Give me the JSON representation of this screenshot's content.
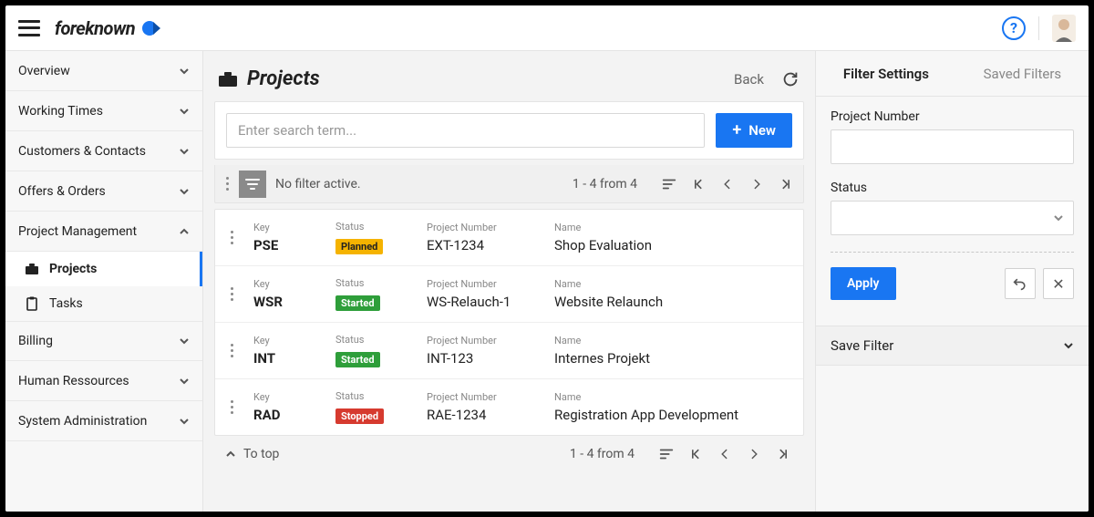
{
  "brand": "foreknown",
  "sidebar": {
    "items": [
      {
        "label": "Overview",
        "expanded": false
      },
      {
        "label": "Working Times",
        "expanded": false
      },
      {
        "label": "Customers & Contacts",
        "expanded": false
      },
      {
        "label": "Offers & Orders",
        "expanded": false
      },
      {
        "label": "Project Management",
        "expanded": true,
        "children": [
          {
            "label": "Projects",
            "active": true
          },
          {
            "label": "Tasks",
            "active": false
          }
        ]
      },
      {
        "label": "Billing",
        "expanded": false
      },
      {
        "label": "Human Ressources",
        "expanded": false
      },
      {
        "label": "System Administration",
        "expanded": false
      }
    ]
  },
  "page": {
    "title": "Projects",
    "back_label": "Back"
  },
  "search": {
    "placeholder": "Enter search term...",
    "new_label": "New"
  },
  "filter_bar": {
    "status_text": "No filter active.",
    "range_text": "1 - 4 from 4"
  },
  "columns": {
    "key": "Key",
    "status": "Status",
    "project_number": "Project Number",
    "name": "Name"
  },
  "rows": [
    {
      "key": "PSE",
      "status": "Planned",
      "project_number": "EXT-1234",
      "name": "Shop Evaluation"
    },
    {
      "key": "WSR",
      "status": "Started",
      "project_number": "WS-Relauch-1",
      "name": "Website Relaunch"
    },
    {
      "key": "INT",
      "status": "Started",
      "project_number": "INT-123",
      "name": "Internes Projekt"
    },
    {
      "key": "RAD",
      "status": "Stopped",
      "project_number": "RAE-1234",
      "name": "Registration App Development"
    }
  ],
  "bottom_bar": {
    "to_top": "To top",
    "range_text": "1 - 4 from 4"
  },
  "filter_panel": {
    "tabs": {
      "settings": "Filter Settings",
      "saved": "Saved Filters"
    },
    "project_number_label": "Project Number",
    "status_label": "Status",
    "apply_label": "Apply",
    "save_filter_label": "Save Filter"
  }
}
